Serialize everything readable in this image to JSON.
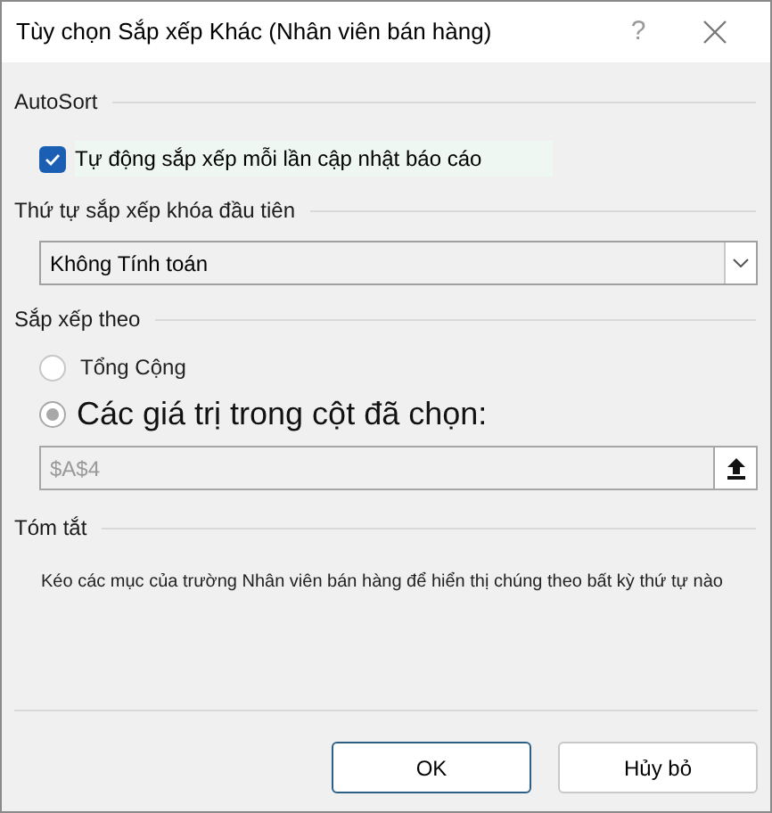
{
  "window": {
    "title": "Tùy chọn Sắp xếp Khác (Nhân viên bán hàng)",
    "help": "?"
  },
  "autosort": {
    "heading": "AutoSort",
    "checkbox": {
      "label": "Tự động sắp xếp mỗi lần cập nhật báo cáo",
      "checked": true
    }
  },
  "first_key": {
    "heading": "Thứ tự sắp xếp khóa đầu tiên",
    "value": "Không Tính toán"
  },
  "sort_by": {
    "heading": "Sắp xếp theo",
    "options": [
      {
        "label": "Tổng Cộng",
        "selected": false,
        "large": false
      },
      {
        "label": "Các giá trị trong cột đã chọn:",
        "selected": true,
        "large": true
      }
    ],
    "field": {
      "value": "$A$4",
      "disabled": true
    }
  },
  "summary": {
    "heading": "Tóm tắt",
    "text": "Kéo các mục của trường Nhân viên bán hàng để hiển thị chúng theo bất kỳ thứ tự nào"
  },
  "buttons": [
    {
      "label": "OK",
      "default": true
    },
    {
      "label": "Hủy bỏ",
      "default": false
    }
  ]
}
